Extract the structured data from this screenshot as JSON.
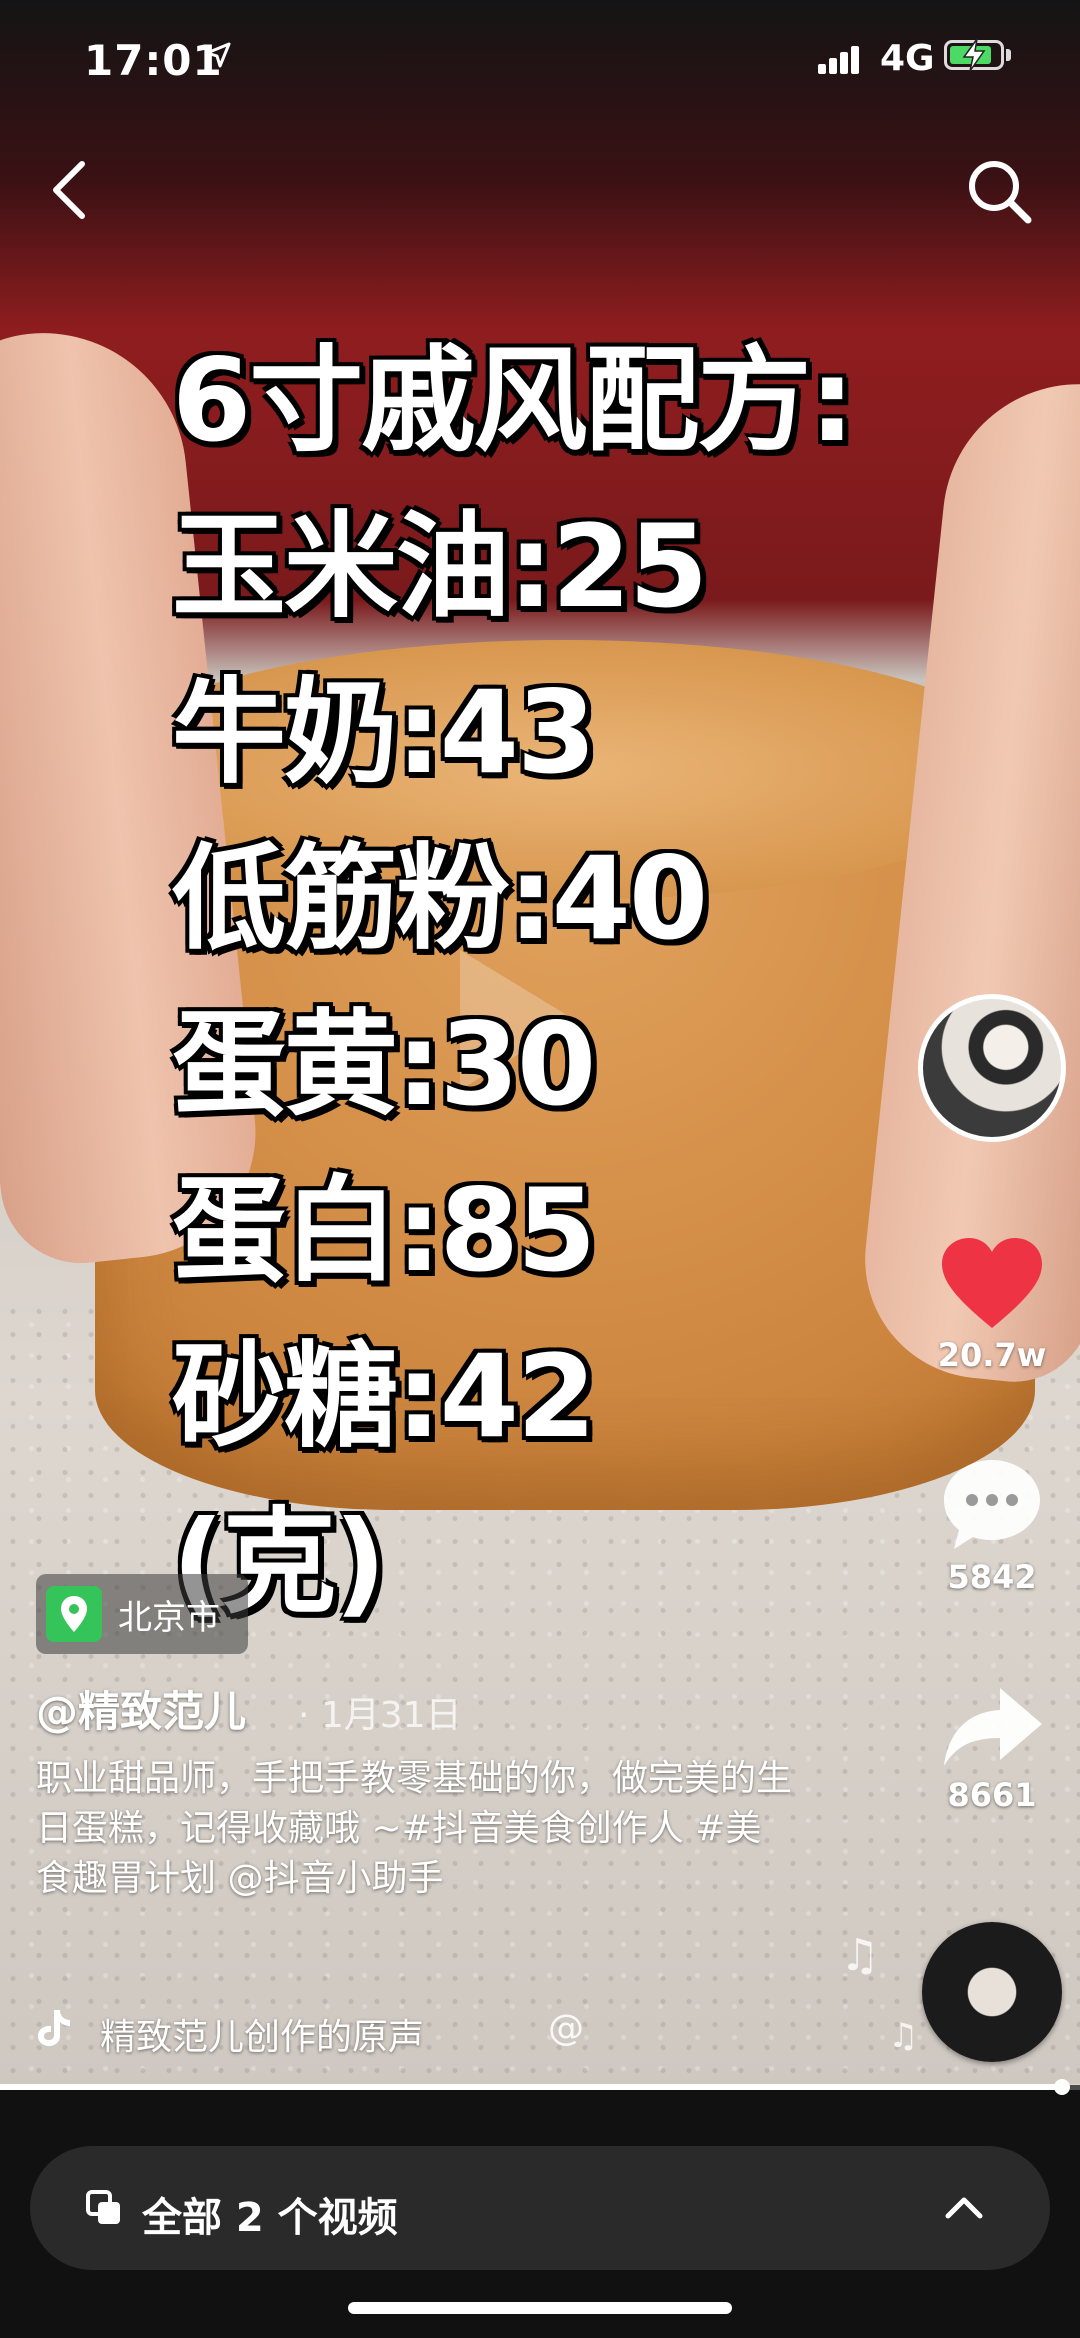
{
  "status_bar": {
    "time": "17:01",
    "network": "4G",
    "battery_level": 0.85
  },
  "nav": {
    "back_icon": "chevron-left-icon",
    "search_icon": "search-icon"
  },
  "overlay_text": {
    "title": "6寸戚风配方:",
    "lines": [
      "玉米油:25",
      "牛奶:43",
      "低筋粉:40",
      "蛋黄:30",
      "蛋白:85",
      "砂糖:42",
      "(克)"
    ]
  },
  "actions": {
    "likes": "20.7w",
    "comments": "5842",
    "shares": "8661"
  },
  "location": {
    "label": "北京市"
  },
  "post": {
    "author": "@精致范儿",
    "date": "· 1月31日",
    "caption": "职业甜品师，手把手教零基础的你，做完美的生日蛋糕，记得收藏哦 ~#抖音美食创作人 #美食趣胃计划 @抖音小助手",
    "music": "精致范儿创作的原声",
    "music_extra": "@"
  },
  "progress": {
    "fraction": 0.98
  },
  "collection": {
    "label": "全部 2 个视频"
  },
  "colors": {
    "like_red": "#ee3344",
    "location_green": "#35c45a",
    "battery_green": "#4cd964"
  }
}
